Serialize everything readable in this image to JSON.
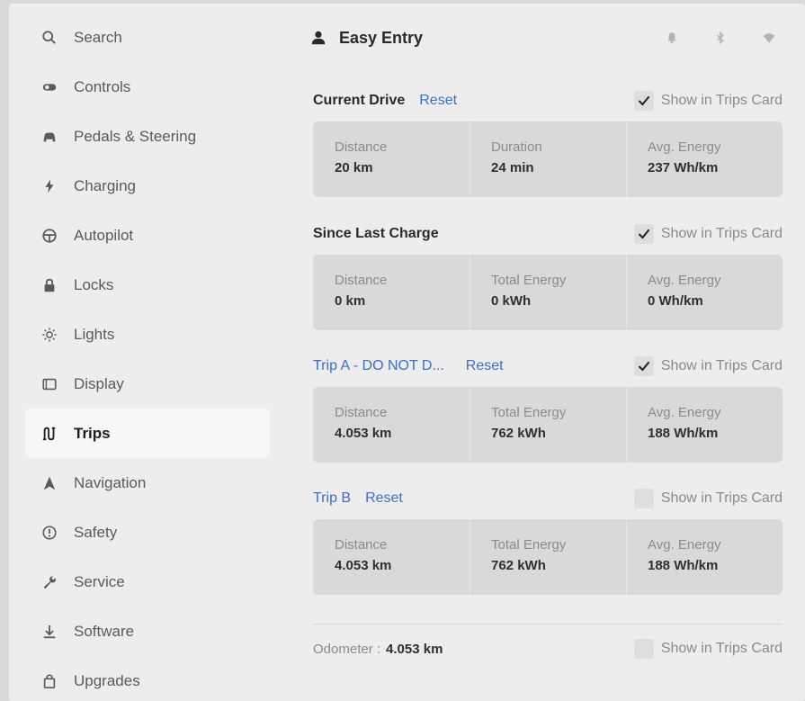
{
  "sidebar": {
    "items": [
      {
        "label": "Search",
        "icon": "search-icon"
      },
      {
        "label": "Controls",
        "icon": "toggle-icon"
      },
      {
        "label": "Pedals & Steering",
        "icon": "car-icon"
      },
      {
        "label": "Charging",
        "icon": "lightning-icon"
      },
      {
        "label": "Autopilot",
        "icon": "steering-wheel-icon"
      },
      {
        "label": "Locks",
        "icon": "lock-icon"
      },
      {
        "label": "Lights",
        "icon": "sun-icon"
      },
      {
        "label": "Display",
        "icon": "display-icon"
      },
      {
        "label": "Trips",
        "icon": "trips-icon",
        "active": true
      },
      {
        "label": "Navigation",
        "icon": "navigation-icon"
      },
      {
        "label": "Safety",
        "icon": "info-icon"
      },
      {
        "label": "Service",
        "icon": "wrench-icon"
      },
      {
        "label": "Software",
        "icon": "download-icon"
      },
      {
        "label": "Upgrades",
        "icon": "bag-icon"
      }
    ]
  },
  "header": {
    "profile_name": "Easy Entry",
    "icons": [
      "bell-icon",
      "bluetooth-icon",
      "wifi-icon"
    ]
  },
  "show_in_trips_label": "Show in Trips Card",
  "current_drive": {
    "title": "Current Drive",
    "reset": "Reset",
    "show_checked": true,
    "stats": [
      {
        "label": "Distance",
        "value": "20 km"
      },
      {
        "label": "Duration",
        "value": "24 min"
      },
      {
        "label": "Avg. Energy",
        "value": "237 Wh/km"
      }
    ]
  },
  "since_last_charge": {
    "title": "Since Last Charge",
    "show_checked": true,
    "stats": [
      {
        "label": "Distance",
        "value": "0 km"
      },
      {
        "label": "Total Energy",
        "value": "0 kWh"
      },
      {
        "label": "Avg. Energy",
        "value": "0 Wh/km"
      }
    ]
  },
  "trip_a": {
    "title": "Trip A - DO NOT D...",
    "reset": "Reset",
    "show_checked": true,
    "stats": [
      {
        "label": "Distance",
        "value": "4.053 km"
      },
      {
        "label": "Total Energy",
        "value": "762 kWh"
      },
      {
        "label": "Avg. Energy",
        "value": "188 Wh/km"
      }
    ]
  },
  "trip_b": {
    "title": "Trip B",
    "reset": "Reset",
    "show_checked": false,
    "stats": [
      {
        "label": "Distance",
        "value": "4.053 km"
      },
      {
        "label": "Total Energy",
        "value": "762 kWh"
      },
      {
        "label": "Avg. Energy",
        "value": "188 Wh/km"
      }
    ]
  },
  "odometer": {
    "label": "Odometer :",
    "value": "4.053 km",
    "show_checked": false
  },
  "colors": {
    "accent": "#3d6ec9",
    "background": "#ededed",
    "card": "#d9d9d9"
  }
}
